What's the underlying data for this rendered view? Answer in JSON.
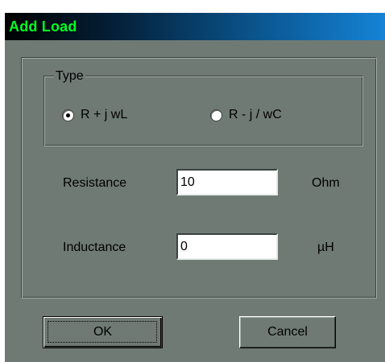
{
  "window": {
    "title": "Add Load",
    "title_color": "#00ff22",
    "body_color": "#6f7a75"
  },
  "type_group": {
    "legend": "Type",
    "options": [
      {
        "label": "R + j wL",
        "selected": true
      },
      {
        "label": "R - j / wC",
        "selected": false
      }
    ]
  },
  "fields": {
    "resistance": {
      "label": "Resistance",
      "value": "10",
      "unit": "Ohm"
    },
    "inductance": {
      "label": "Inductance",
      "value": "0",
      "unit": "µH"
    }
  },
  "buttons": {
    "ok_label": "OK",
    "cancel_label": "Cancel"
  }
}
